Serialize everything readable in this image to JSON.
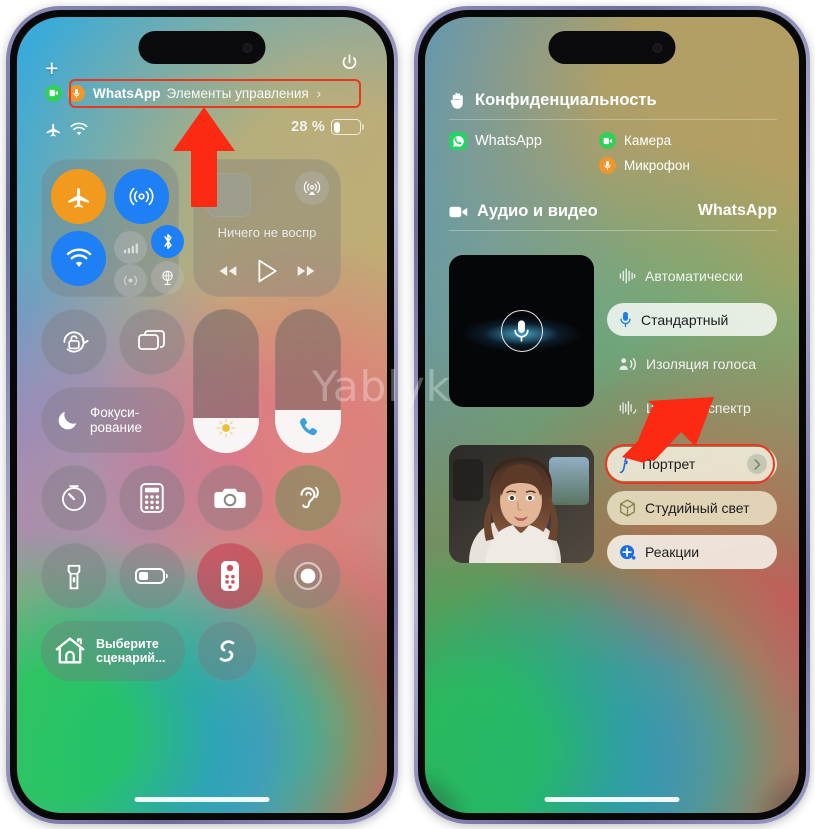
{
  "watermark": "Yablyk",
  "colors": {
    "accent_red": "#e8381f",
    "green": "#30d158",
    "orange": "#f0962c",
    "blue": "#1f7ff5",
    "whatsapp_green": "#25d366"
  },
  "left_phone": {
    "status": {
      "add_label": "+",
      "power_icon": "power-icon",
      "airplane_icon": "airplane-mode-icon",
      "wifi_icon": "wifi-icon",
      "battery_percent": "28 %",
      "battery_level": 28
    },
    "privacy_pill": {
      "camera_icon": "camera-icon",
      "mic_icon": "microphone-icon",
      "app": "WhatsApp",
      "subtitle": "Элементы управления",
      "chevron": "›",
      "highlighted": true
    },
    "connectivity": {
      "airplane": {
        "name": "airplane-mode",
        "state": "on",
        "icon": "airplane-icon"
      },
      "airdrop": {
        "name": "airdrop",
        "state": "on",
        "icon": "airdrop-icon"
      },
      "wifi": {
        "name": "wifi",
        "state": "on",
        "icon": "wifi-icon"
      },
      "cellular": {
        "name": "cellular-data",
        "state": "off",
        "icon": "antenna-icon"
      },
      "bluetooth": {
        "name": "bluetooth",
        "state": "on",
        "icon": "bluetooth-icon"
      },
      "hotspot": {
        "name": "personal-hotspot",
        "state": "off",
        "icon": "hotspot-icon"
      },
      "vpn": {
        "name": "vpn",
        "state": "off",
        "icon": "globe-icon"
      }
    },
    "media": {
      "title": "Ничего не воспр",
      "airplay_icon": "airplay-icon",
      "prev_icon": "rewind-icon",
      "play_icon": "play-icon",
      "next_icon": "fast-forward-icon"
    },
    "tiles": {
      "rotation_lock": "rotation-lock-icon",
      "screen_mirroring": "screen-mirroring-icon",
      "focus_label": "Фокуси-\nрование",
      "focus_line1": "Фокуси-",
      "focus_line2": "рование",
      "brightness_value": 24,
      "brightness_icon": "brightness-icon",
      "volume_value": 30,
      "volume_icon": "phone-handset-icon"
    },
    "shortcuts": [
      {
        "name": "timer",
        "icon": "timer-icon"
      },
      {
        "name": "calculator",
        "icon": "calculator-icon"
      },
      {
        "name": "camera",
        "icon": "camera-icon"
      },
      {
        "name": "hearing",
        "icon": "ear-icon"
      },
      {
        "name": "flashlight",
        "icon": "flashlight-icon"
      },
      {
        "name": "low-power-mode",
        "icon": "battery-icon"
      },
      {
        "name": "apple-tv-remote",
        "icon": "remote-icon"
      },
      {
        "name": "screen-record",
        "icon": "record-icon"
      }
    ],
    "home": {
      "icon": "home-icon",
      "line1": "Выберите",
      "line2": "сценарий..."
    },
    "shazam": {
      "icon": "shazam-icon"
    }
  },
  "right_phone": {
    "privacy": {
      "header": "Конфиденциальность",
      "header_icon": "hand-raised-icon",
      "app": "WhatsApp",
      "app_icon": "whatsapp-icon",
      "usages": [
        {
          "label": "Камера",
          "icon": "camera-icon",
          "color": "#30d158"
        },
        {
          "label": "Микрофон",
          "icon": "microphone-icon",
          "color": "#f0962c"
        }
      ]
    },
    "audio_video": {
      "header": "Аудио и видео",
      "header_icon": "video-icon",
      "app": "WhatsApp"
    },
    "mic_modes": {
      "preview_icon": "microphone-icon",
      "options": [
        {
          "label": "Автоматически",
          "icon": "waveform-icon",
          "selected": false
        },
        {
          "label": "Стандартный",
          "icon": "microphone-icon",
          "selected": true
        },
        {
          "label": "Изоляция голоса",
          "icon": "voice-isolation-icon",
          "selected": false
        },
        {
          "label": "Широкий спектр",
          "icon": "wide-spectrum-icon",
          "selected": false
        }
      ]
    },
    "video_effects": {
      "options": [
        {
          "label": "Портрет",
          "icon": "portrait-f-icon",
          "selected": true,
          "chevron": "›",
          "highlighted": true
        },
        {
          "label": "Студийный свет",
          "icon": "cube-icon",
          "selected": true,
          "chevron": "",
          "highlighted": false
        },
        {
          "label": "Реакции",
          "icon": "reactions-icon",
          "selected": true,
          "chevron": "",
          "highlighted": false
        }
      ]
    }
  },
  "annotations": [
    {
      "name": "arrow-up-to-privacy-pill",
      "direction": "up",
      "target": "privacy-pill"
    },
    {
      "name": "arrow-down-to-portrait",
      "direction": "down-left",
      "target": "portrait-option"
    }
  ]
}
